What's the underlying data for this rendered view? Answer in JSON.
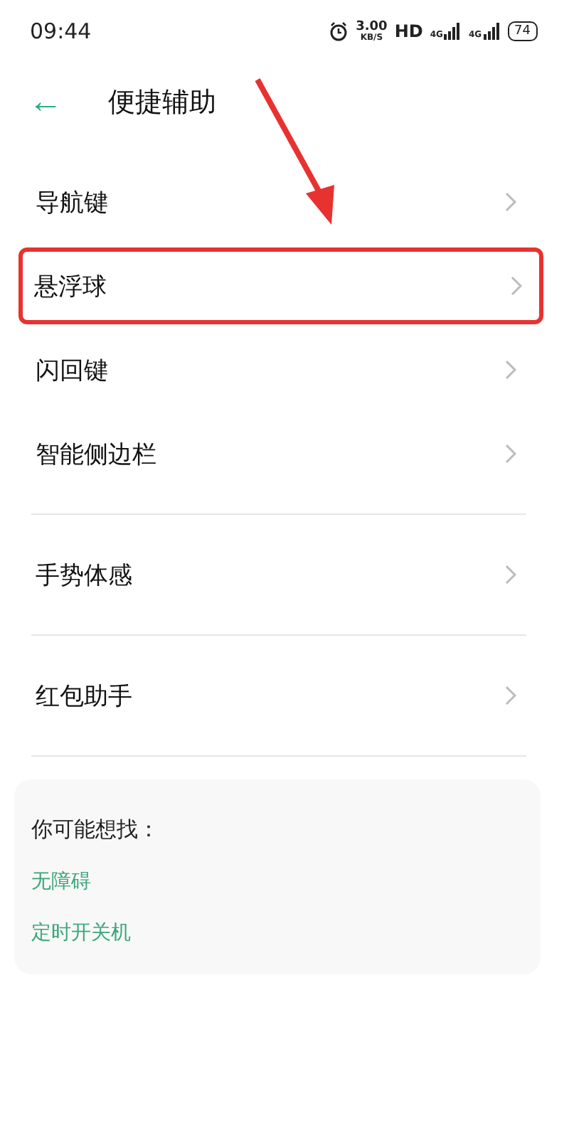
{
  "status_bar": {
    "time": "09:44",
    "speed": "3.00",
    "speed_unit": "KB/S",
    "hd": "HD",
    "networks": [
      "4G",
      "4G"
    ],
    "battery": "74"
  },
  "header": {
    "back": "←",
    "title": "便捷辅助"
  },
  "groups": [
    {
      "items": [
        {
          "label": "导航键",
          "highlighted": false
        },
        {
          "label": "悬浮球",
          "highlighted": true
        },
        {
          "label": "闪回键",
          "highlighted": false
        },
        {
          "label": "智能侧边栏",
          "highlighted": false
        }
      ]
    },
    {
      "items": [
        {
          "label": "手势体感",
          "highlighted": false
        }
      ]
    },
    {
      "items": [
        {
          "label": "红包助手",
          "highlighted": false
        }
      ]
    }
  ],
  "suggestions": {
    "title": "你可能想找：",
    "links": [
      "无障碍",
      "定时开关机"
    ]
  }
}
